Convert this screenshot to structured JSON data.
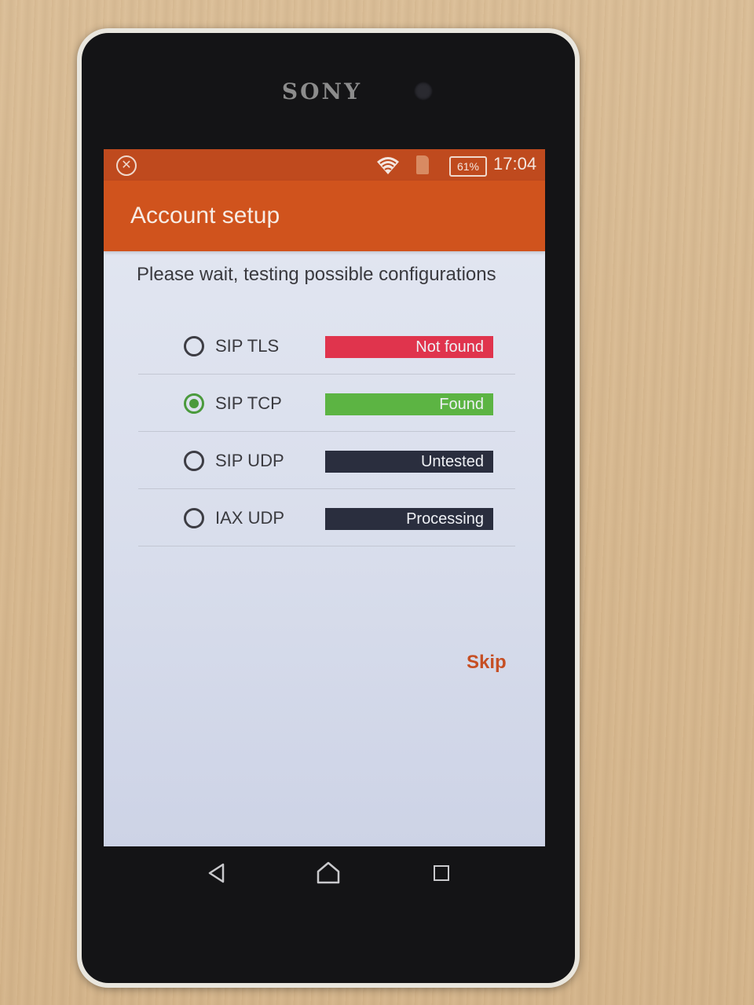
{
  "device": {
    "brand": "SONY"
  },
  "status_bar": {
    "battery": "61%",
    "time": "17:04",
    "close_icon": "close-circle-icon",
    "wifi_icon": "wifi-icon",
    "sim_icon": "sim-alert-icon"
  },
  "app_bar": {
    "title": "Account setup"
  },
  "instruction": "Please wait, testing possible configurations",
  "options": [
    {
      "label": "SIP TLS",
      "status": "Not found",
      "selected": false,
      "status_color": "#e0344d"
    },
    {
      "label": "SIP TCP",
      "status": "Found",
      "selected": true,
      "status_color": "#5cb443"
    },
    {
      "label": "SIP UDP",
      "status": "Untested",
      "selected": false,
      "status_color": "#2a2e3e"
    },
    {
      "label": "IAX UDP",
      "status": "Processing",
      "selected": false,
      "status_color": "#2a2e3e"
    }
  ],
  "skip_label": "Skip",
  "colors": {
    "status_bar": "#bf4a1e",
    "app_bar": "#d0531d",
    "accent": "#c64f24",
    "selected_radio": "#4a9a3c"
  },
  "nav": {
    "back_icon": "back-triangle-icon",
    "home_icon": "home-icon",
    "recent_icon": "recent-apps-icon"
  }
}
